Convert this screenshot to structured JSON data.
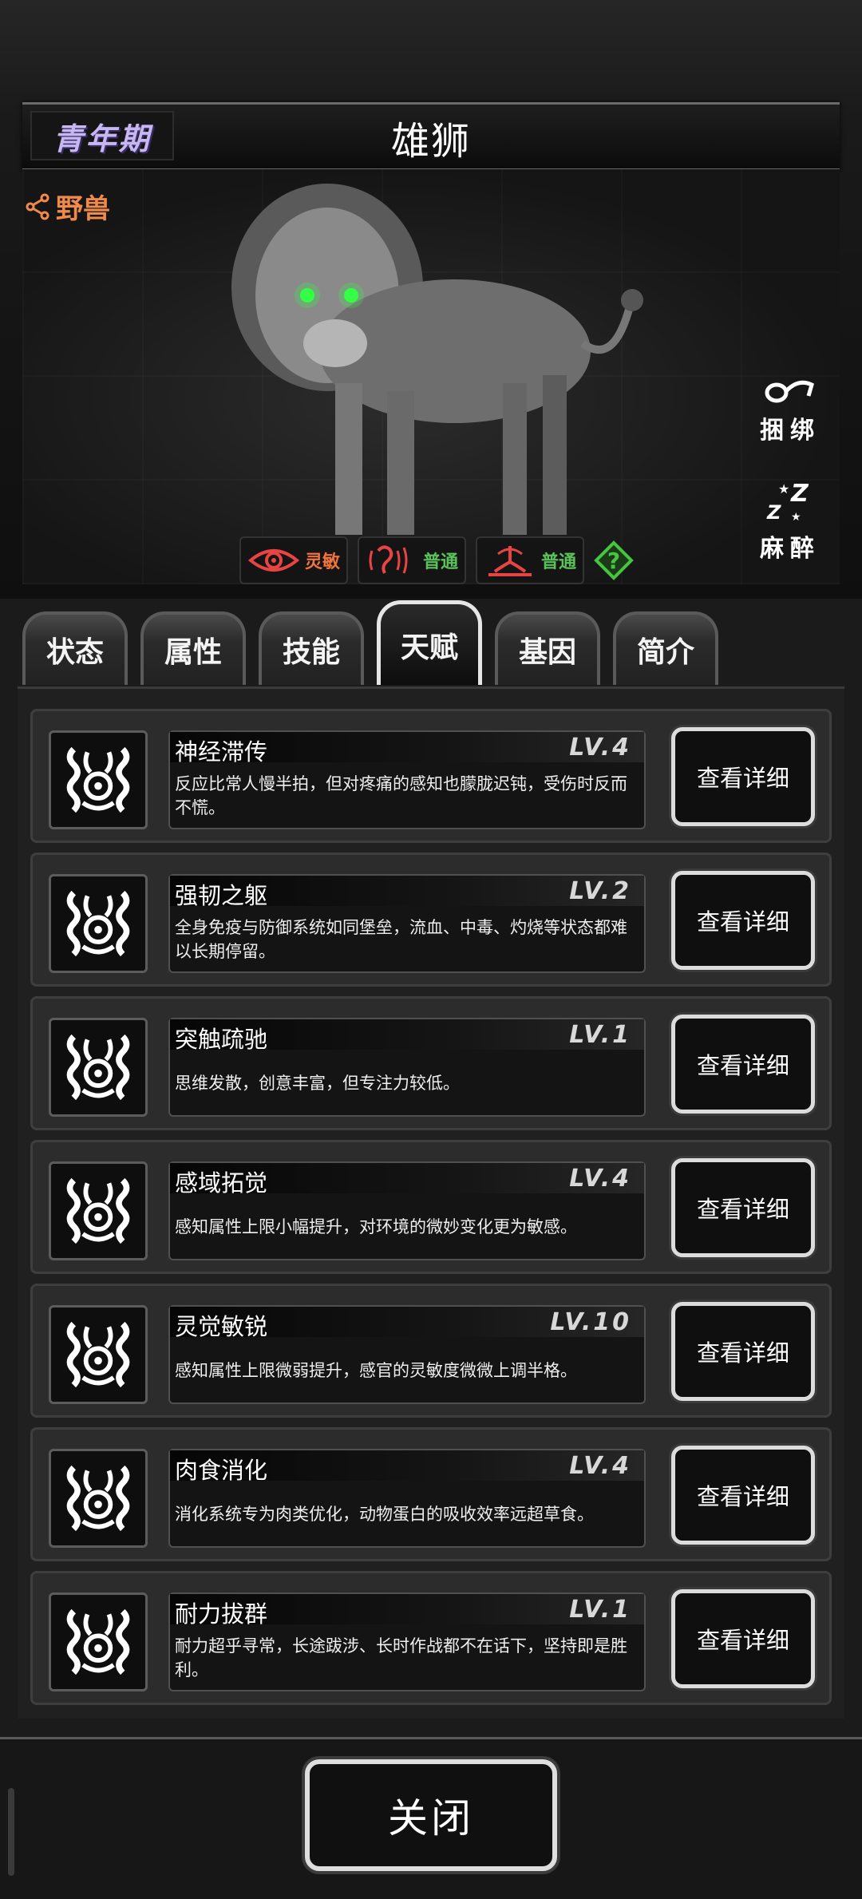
{
  "header": {
    "stage": "青年期",
    "name": "雄狮",
    "category": "野兽"
  },
  "side_actions": [
    {
      "label": "捆绑",
      "icon": "rope-icon"
    },
    {
      "label": "麻醉",
      "icon": "sleep-icon"
    }
  ],
  "senses": [
    {
      "icon": "eye-icon",
      "value": "灵敏",
      "color": "#f0743e"
    },
    {
      "icon": "ear-icon",
      "value": "普通",
      "color": "#59c35a"
    },
    {
      "icon": "nose-icon",
      "value": "普通",
      "color": "#59c35a"
    }
  ],
  "tabs": [
    "状态",
    "属性",
    "技能",
    "天赋",
    "基因",
    "简介"
  ],
  "active_tab": "天赋",
  "talents": [
    {
      "name": "神经滞传",
      "level": "LV.4",
      "desc": "反应比常人慢半拍，但对疼痛的感知也朦胧迟钝，受伤时反而不慌。"
    },
    {
      "name": "强韧之躯",
      "level": "LV.2",
      "desc": "全身免疫与防御系统如同堡垒，流血、中毒、灼烧等状态都难以长期停留。"
    },
    {
      "name": "突触疏驰",
      "level": "LV.1",
      "desc": "思维发散，创意丰富，但专注力较低。"
    },
    {
      "name": "感域拓觉",
      "level": "LV.4",
      "desc": "感知属性上限小幅提升，对环境的微妙变化更为敏感。"
    },
    {
      "name": "灵觉敏锐",
      "level": "LV.10",
      "desc": "感知属性上限微弱提升，感官的灵敏度微微上调半格。"
    },
    {
      "name": "肉食消化",
      "level": "LV.4",
      "desc": "消化系统专为肉类优化，动物蛋白的吸收效率远超草食。"
    },
    {
      "name": "耐力拔群",
      "level": "LV.1",
      "desc": "耐力超乎寻常，长途跋涉、长时作战都不在话下，坚持即是胜利。"
    }
  ],
  "detail_label": "查看详细",
  "close_label": "关闭"
}
